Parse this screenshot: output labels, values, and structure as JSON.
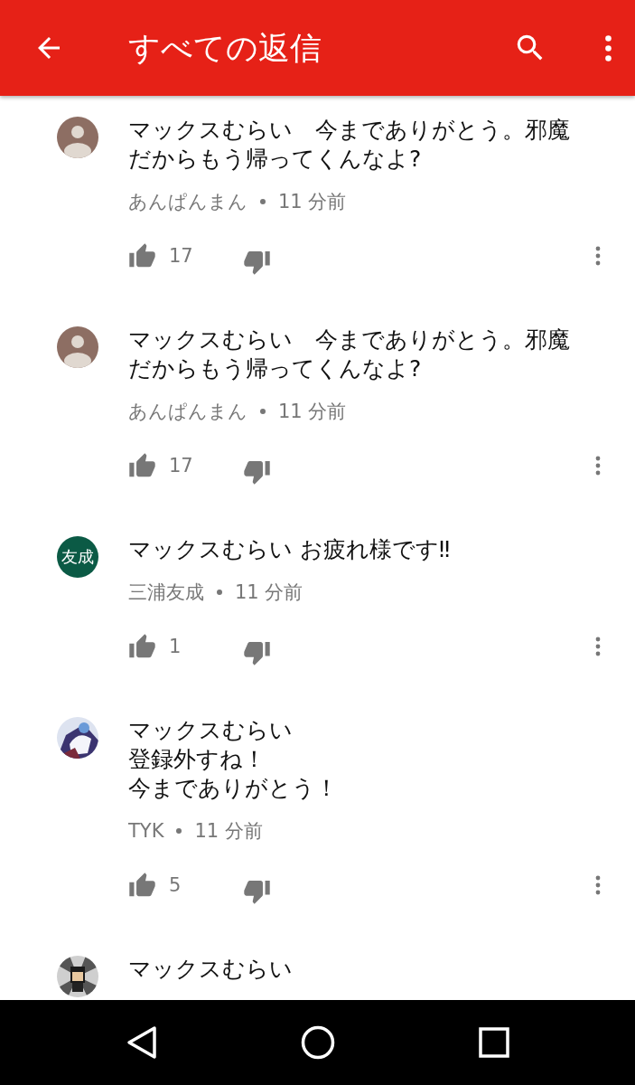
{
  "app_bar": {
    "title": "すべての返信"
  },
  "comments": [
    {
      "avatar": {
        "kind": "default"
      },
      "lines": [
        "マックスむらい　今までありがとう。邪魔",
        "だからもう帰ってくんなよ?"
      ],
      "author": "あんぱんまん",
      "time": "11 分前",
      "likes": "17"
    },
    {
      "avatar": {
        "kind": "default"
      },
      "lines": [
        "マックスむらい　今までありがとう。邪魔",
        "だからもう帰ってくんなよ?"
      ],
      "author": "あんぱんまん",
      "time": "11 分前",
      "likes": "17"
    },
    {
      "avatar": {
        "kind": "initials",
        "text": "友成",
        "color": "#0b5a45"
      },
      "lines": [
        "マックスむらい お疲れ様です‼"
      ],
      "author": "三浦友成",
      "time": "11 分前",
      "likes": "1"
    },
    {
      "avatar": {
        "kind": "picture"
      },
      "lines": [
        "マックスむらい",
        "登録外すね！",
        "今までありがとう！"
      ],
      "author": "TYK",
      "time": "11 分前",
      "likes": "5"
    },
    {
      "avatar": {
        "kind": "picture"
      },
      "lines": [
        "マックスむらい"
      ]
    }
  ]
}
